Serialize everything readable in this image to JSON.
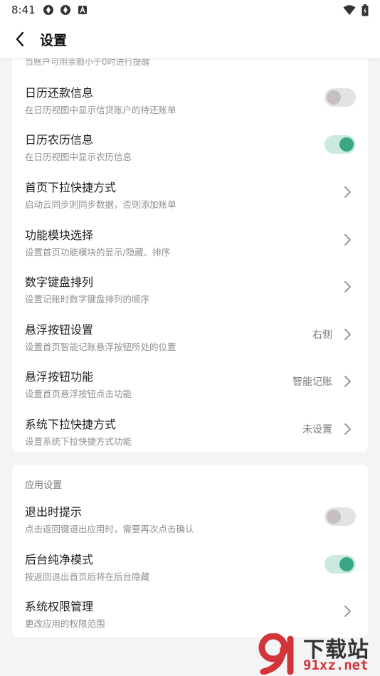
{
  "status": {
    "time": "8:41"
  },
  "header": {
    "title": "设置"
  },
  "card1": {
    "partial_text": "当账户可用余额小于0时进行提醒",
    "rows": [
      {
        "title": "日历还款信息",
        "subtitle": "在日历视图中显示信贷账户的待还账单",
        "toggle": "off"
      },
      {
        "title": "日历农历信息",
        "subtitle": "在日历视图中显示农历信息",
        "toggle": "on"
      },
      {
        "title": "首页下拉快捷方式",
        "subtitle": "启动云同步则同步数据，否则添加账单"
      },
      {
        "title": "功能模块选择",
        "subtitle": "设置首页功能模块的显示/隐藏、排序"
      },
      {
        "title": "数字键盘排列",
        "subtitle": "设置记账时数字键盘排列的顺序"
      },
      {
        "title": "悬浮按钮设置",
        "subtitle": "设置首页智能记账悬浮按钮所处的位置",
        "value": "右侧"
      },
      {
        "title": "悬浮按钮功能",
        "subtitle": "设置首页悬浮按钮点击功能",
        "value": "智能记账"
      },
      {
        "title": "系统下拉快捷方式",
        "subtitle": "设置系统下拉快捷方式功能",
        "value": "未设置"
      }
    ]
  },
  "card2": {
    "section_label": "应用设置",
    "rows": [
      {
        "title": "退出时提示",
        "subtitle": "点击返回键退出应用时，需要再次点击确认",
        "toggle": "off"
      },
      {
        "title": "后台纯净模式",
        "subtitle": "按返回退出首页后将在后台隐藏",
        "toggle": "on"
      },
      {
        "title": "系统权限管理",
        "subtitle": "更改应用的权限范围"
      }
    ]
  },
  "watermark": {
    "text_cn": "下载站",
    "text_url": "91xz.net"
  },
  "colors": {
    "accent": "#3aa685",
    "toggle_on_track": "#c9eadd",
    "toggle_off_track": "#e3e3e6",
    "background": "#f4f4f6"
  }
}
